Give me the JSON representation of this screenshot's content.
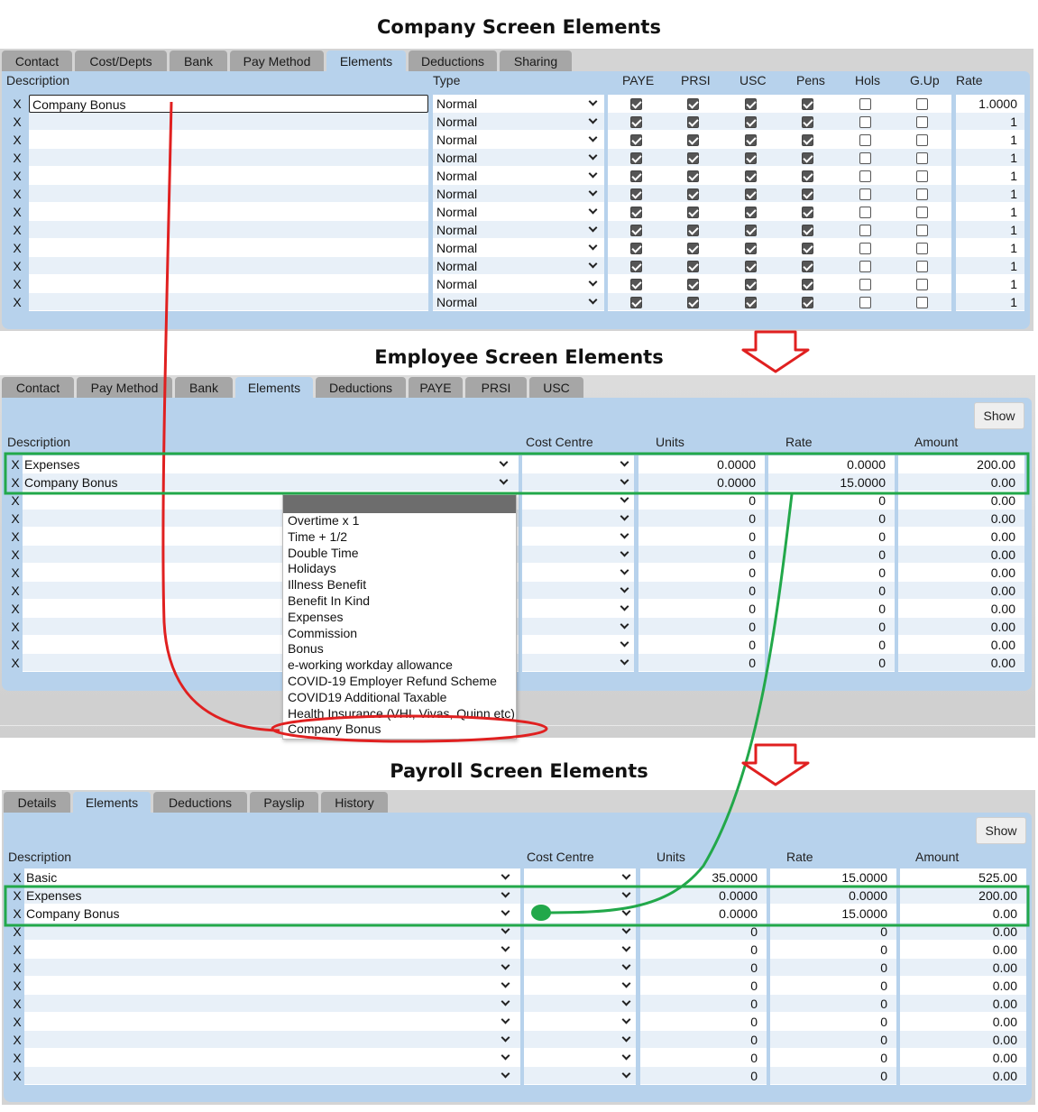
{
  "titles": {
    "company": "Company Screen Elements",
    "employee": "Employee Screen Elements",
    "payroll": "Payroll Screen Elements"
  },
  "company": {
    "tabs": [
      "Contact",
      "Cost/Depts",
      "Bank",
      "Pay Method",
      "Elements",
      "Deductions",
      "Sharing"
    ],
    "active_tab": "Elements",
    "headers": {
      "description": "Description",
      "type": "Type",
      "paye": "PAYE",
      "prsi": "PRSI",
      "usc": "USC",
      "pens": "Pens",
      "hols": "Hols",
      "gup": "G.Up",
      "rate": "Rate"
    },
    "delete_label": "X",
    "rows": [
      {
        "description": "Company Bonus",
        "type": "Normal",
        "rate": "1.0000"
      },
      {
        "description": "",
        "type": "Normal",
        "rate": "1"
      },
      {
        "description": "",
        "type": "Normal",
        "rate": "1"
      },
      {
        "description": "",
        "type": "Normal",
        "rate": "1"
      },
      {
        "description": "",
        "type": "Normal",
        "rate": "1"
      },
      {
        "description": "",
        "type": "Normal",
        "rate": "1"
      },
      {
        "description": "",
        "type": "Normal",
        "rate": "1"
      },
      {
        "description": "",
        "type": "Normal",
        "rate": "1"
      },
      {
        "description": "",
        "type": "Normal",
        "rate": "1"
      },
      {
        "description": "",
        "type": "Normal",
        "rate": "1"
      },
      {
        "description": "",
        "type": "Normal",
        "rate": "1"
      },
      {
        "description": "",
        "type": "Normal",
        "rate": "1"
      }
    ],
    "checkbox_defaults": {
      "paye": true,
      "prsi": true,
      "usc": true,
      "pens": true,
      "hols": false,
      "gup": false
    }
  },
  "employee": {
    "tabs": [
      "Contact",
      "Pay Method",
      "Bank",
      "Elements",
      "Deductions",
      "PAYE",
      "PRSI",
      "USC"
    ],
    "active_tab": "Elements",
    "show_label": "Show",
    "headers": {
      "description": "Description",
      "cost_centre": "Cost Centre",
      "units": "Units",
      "rate": "Rate",
      "amount": "Amount"
    },
    "delete_label": "X",
    "rows": [
      {
        "description": "Expenses",
        "units": "0.0000",
        "rate": "0.0000",
        "amount": "200.00"
      },
      {
        "description": "Company Bonus",
        "units": "0.0000",
        "rate": "15.0000",
        "amount": "0.00"
      },
      {
        "description": "",
        "units": "0",
        "rate": "0",
        "amount": "0.00"
      },
      {
        "description": "",
        "units": "0",
        "rate": "0",
        "amount": "0.00"
      },
      {
        "description": "",
        "units": "0",
        "rate": "0",
        "amount": "0.00"
      },
      {
        "description": "",
        "units": "0",
        "rate": "0",
        "amount": "0.00"
      },
      {
        "description": "",
        "units": "0",
        "rate": "0",
        "amount": "0.00"
      },
      {
        "description": "",
        "units": "0",
        "rate": "0",
        "amount": "0.00"
      },
      {
        "description": "",
        "units": "0",
        "rate": "0",
        "amount": "0.00"
      },
      {
        "description": "",
        "units": "0",
        "rate": "0",
        "amount": "0.00"
      },
      {
        "description": "",
        "units": "0",
        "rate": "0",
        "amount": "0.00"
      },
      {
        "description": "",
        "units": "0",
        "rate": "0",
        "amount": "0.00"
      }
    ],
    "dropdown_options": [
      "Overtime x 1",
      "Time + 1/2",
      "Double Time",
      "Holidays",
      "Illness Benefit",
      "Benefit In Kind",
      "Expenses",
      "Commission",
      "Bonus",
      "e-working workday allowance",
      "COVID-19 Employer Refund Scheme",
      "COVID19 Additional Taxable",
      "Health Insurance (VHI, Vivas, Quinn etc)",
      "Company Bonus"
    ]
  },
  "payroll": {
    "tabs": [
      "Details",
      "Elements",
      "Deductions",
      "Payslip",
      "History"
    ],
    "active_tab": "Elements",
    "show_label": "Show",
    "headers": {
      "description": "Description",
      "cost_centre": "Cost Centre",
      "units": "Units",
      "rate": "Rate",
      "amount": "Amount"
    },
    "delete_label": "X",
    "rows": [
      {
        "description": "Basic",
        "units": "35.0000",
        "rate": "15.0000",
        "amount": "525.00"
      },
      {
        "description": "Expenses",
        "units": "0.0000",
        "rate": "0.0000",
        "amount": "200.00"
      },
      {
        "description": "Company Bonus",
        "units": "0.0000",
        "rate": "15.0000",
        "amount": "0.00"
      },
      {
        "description": "",
        "units": "0",
        "rate": "0",
        "amount": "0.00"
      },
      {
        "description": "",
        "units": "0",
        "rate": "0",
        "amount": "0.00"
      },
      {
        "description": "",
        "units": "0",
        "rate": "0",
        "amount": "0.00"
      },
      {
        "description": "",
        "units": "0",
        "rate": "0",
        "amount": "0.00"
      },
      {
        "description": "",
        "units": "0",
        "rate": "0",
        "amount": "0.00"
      },
      {
        "description": "",
        "units": "0",
        "rate": "0",
        "amount": "0.00"
      },
      {
        "description": "",
        "units": "0",
        "rate": "0",
        "amount": "0.00"
      },
      {
        "description": "",
        "units": "0",
        "rate": "0",
        "amount": "0.00"
      },
      {
        "description": "",
        "units": "0",
        "rate": "0",
        "amount": "0.00"
      }
    ]
  },
  "colors": {
    "panel_blue": "#b7d2ec",
    "tab_grey": "#a6a6a6",
    "annotation_red": "#e02020",
    "annotation_green": "#22a84a"
  }
}
